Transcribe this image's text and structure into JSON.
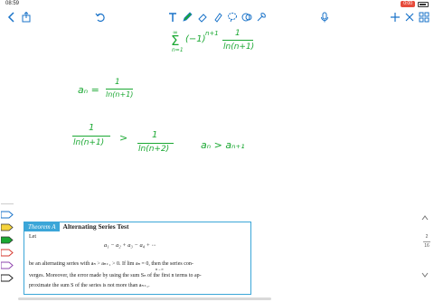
{
  "status": {
    "time": "08:59",
    "rec_label": "0:00"
  },
  "toolbar": {
    "left_icons": [
      "back-icon",
      "share-icon",
      "undo-icon"
    ],
    "tools": [
      "text-tool-icon",
      "pen-tool-icon",
      "eraser-icon",
      "highlighter-icon",
      "lasso-icon",
      "shapes-icon",
      "more-tools-icon"
    ],
    "right_icons": [
      "microphone-icon",
      "add-page-icon",
      "close-icon",
      "grid-icon"
    ]
  },
  "colors": {
    "ink": "#1aa832",
    "accent": "#1a73c9",
    "theorem": "#3ba6d8"
  },
  "handwriting": {
    "series_inf": "∞",
    "series_sigma": "Σ",
    "series_lower": "n=1",
    "series_sign": "(−1)",
    "series_exp": "n+1",
    "series_num": "1",
    "series_den": "ln(n+1)",
    "an_lhs": "aₙ =",
    "an_num": "1",
    "an_den": "ln(n+1)",
    "cmp_left_num": "1",
    "cmp_left_den": "ln(n+1)",
    "cmp_gt": ">",
    "cmp_right_num": "1",
    "cmp_right_den": "ln(n+2)",
    "cmp_result": "aₙ > aₙ₊₁"
  },
  "pager": {
    "current": "2",
    "total": "16"
  },
  "theorem": {
    "tag": "Theorem A",
    "title": "Alternating Series Test",
    "let": "Let",
    "series": "a₁ − a₂ + a₃ − a₄ + ···",
    "line1": "be an alternating series with aₙ > aₙ₊₁ > 0. If lim aₙ = 0, then the series con-",
    "line1_sub": "n→∞",
    "line2": "verges. Moreover, the error made by using the sum Sₙ of the first n terms to ap-",
    "line3": "proximate the sum S of the series is not more than aₙ₊₁."
  }
}
